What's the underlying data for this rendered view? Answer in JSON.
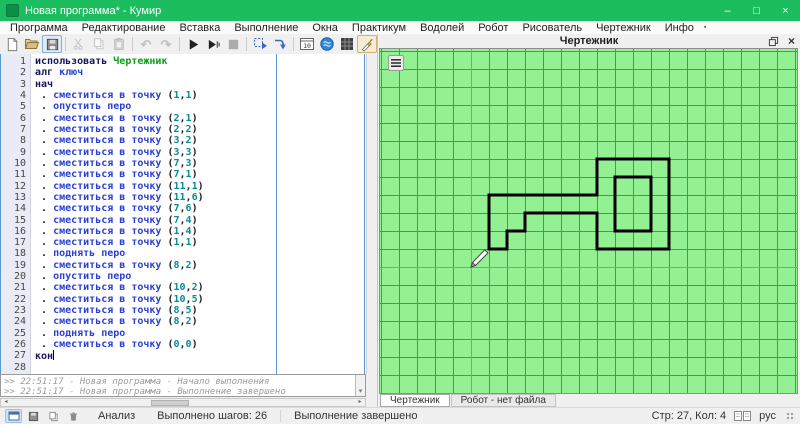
{
  "window": {
    "title": "Новая программа* - Кумир",
    "controls": {
      "minimize": "–",
      "maximize": "□",
      "close": "×"
    }
  },
  "menu": {
    "items": [
      "Программа",
      "Редактирование",
      "Вставка",
      "Выполнение",
      "Окна",
      "Практикум",
      "Водолей",
      "Робот",
      "Рисователь",
      "Чертежник",
      "Инфо"
    ],
    "overflow": "▪"
  },
  "toolbar": {
    "buttons": [
      "new-file",
      "open-file",
      "save-file",
      "cut",
      "copy",
      "paste",
      "undo",
      "redo",
      "run",
      "run-to-end",
      "stop",
      "step-over",
      "step-into",
      "show-variables",
      "vodoley-window",
      "robot-field-window",
      "risovatel-window",
      "robot-window",
      "chertezhnik-window"
    ],
    "vars_label": "10",
    "overflow": "▾"
  },
  "editor": {
    "lines": [
      {
        "n": 1,
        "t": [
          [
            "использовать ",
            "kw"
          ],
          [
            "Чертежник",
            "ac"
          ]
        ]
      },
      {
        "n": 2,
        "t": [
          [
            "алг ",
            "kw"
          ],
          [
            "ключ",
            "cm"
          ]
        ]
      },
      {
        "n": 3,
        "t": [
          [
            "нач",
            "kw"
          ]
        ]
      },
      {
        "n": 4,
        "t": [
          [
            " . ",
            "pl"
          ],
          [
            "сместиться в точку ",
            "cm"
          ],
          [
            "(",
            "pl"
          ],
          [
            "1",
            "nu"
          ],
          [
            ",",
            "pl"
          ],
          [
            "1",
            "nu"
          ],
          [
            ")",
            "pl"
          ]
        ]
      },
      {
        "n": 5,
        "t": [
          [
            " . ",
            "pl"
          ],
          [
            "опустить перо",
            "cm"
          ]
        ]
      },
      {
        "n": 6,
        "t": [
          [
            " . ",
            "pl"
          ],
          [
            "сместиться в точку ",
            "cm"
          ],
          [
            "(",
            "pl"
          ],
          [
            "2",
            "nu"
          ],
          [
            ",",
            "pl"
          ],
          [
            "1",
            "nu"
          ],
          [
            ")",
            "pl"
          ]
        ]
      },
      {
        "n": 7,
        "t": [
          [
            " . ",
            "pl"
          ],
          [
            "сместиться в точку ",
            "cm"
          ],
          [
            "(",
            "pl"
          ],
          [
            "2",
            "nu"
          ],
          [
            ",",
            "pl"
          ],
          [
            "2",
            "nu"
          ],
          [
            ")",
            "pl"
          ]
        ]
      },
      {
        "n": 8,
        "t": [
          [
            " . ",
            "pl"
          ],
          [
            "сместиться в точку ",
            "cm"
          ],
          [
            "(",
            "pl"
          ],
          [
            "3",
            "nu"
          ],
          [
            ",",
            "pl"
          ],
          [
            "2",
            "nu"
          ],
          [
            ")",
            "pl"
          ]
        ]
      },
      {
        "n": 9,
        "t": [
          [
            " . ",
            "pl"
          ],
          [
            "сместиться в точку ",
            "cm"
          ],
          [
            "(",
            "pl"
          ],
          [
            "3",
            "nu"
          ],
          [
            ",",
            "pl"
          ],
          [
            "3",
            "nu"
          ],
          [
            ")",
            "pl"
          ]
        ]
      },
      {
        "n": 10,
        "t": [
          [
            " . ",
            "pl"
          ],
          [
            "сместиться в точку ",
            "cm"
          ],
          [
            "(",
            "pl"
          ],
          [
            "7",
            "nu"
          ],
          [
            ",",
            "pl"
          ],
          [
            "3",
            "nu"
          ],
          [
            ")",
            "pl"
          ]
        ]
      },
      {
        "n": 11,
        "t": [
          [
            " . ",
            "pl"
          ],
          [
            "сместиться в точку ",
            "cm"
          ],
          [
            "(",
            "pl"
          ],
          [
            "7",
            "nu"
          ],
          [
            ",",
            "pl"
          ],
          [
            "1",
            "nu"
          ],
          [
            ")",
            "pl"
          ]
        ]
      },
      {
        "n": 12,
        "t": [
          [
            " . ",
            "pl"
          ],
          [
            "сместиться в точку ",
            "cm"
          ],
          [
            "(",
            "pl"
          ],
          [
            "11",
            "nu"
          ],
          [
            ",",
            "pl"
          ],
          [
            "1",
            "nu"
          ],
          [
            ")",
            "pl"
          ]
        ]
      },
      {
        "n": 13,
        "t": [
          [
            " . ",
            "pl"
          ],
          [
            "сместиться в точку ",
            "cm"
          ],
          [
            "(",
            "pl"
          ],
          [
            "11",
            "nu"
          ],
          [
            ",",
            "pl"
          ],
          [
            "6",
            "nu"
          ],
          [
            ")",
            "pl"
          ]
        ]
      },
      {
        "n": 14,
        "t": [
          [
            " . ",
            "pl"
          ],
          [
            "сместиться в точку ",
            "cm"
          ],
          [
            "(",
            "pl"
          ],
          [
            "7",
            "nu"
          ],
          [
            ",",
            "pl"
          ],
          [
            "6",
            "nu"
          ],
          [
            ")",
            "pl"
          ]
        ]
      },
      {
        "n": 15,
        "t": [
          [
            " . ",
            "pl"
          ],
          [
            "сместиться в точку ",
            "cm"
          ],
          [
            "(",
            "pl"
          ],
          [
            "7",
            "nu"
          ],
          [
            ",",
            "pl"
          ],
          [
            "4",
            "nu"
          ],
          [
            ")",
            "pl"
          ]
        ]
      },
      {
        "n": 16,
        "t": [
          [
            " . ",
            "pl"
          ],
          [
            "сместиться в точку ",
            "cm"
          ],
          [
            "(",
            "pl"
          ],
          [
            "1",
            "nu"
          ],
          [
            ",",
            "pl"
          ],
          [
            "4",
            "nu"
          ],
          [
            ")",
            "pl"
          ]
        ]
      },
      {
        "n": 17,
        "t": [
          [
            " . ",
            "pl"
          ],
          [
            "сместиться в точку ",
            "cm"
          ],
          [
            "(",
            "pl"
          ],
          [
            "1",
            "nu"
          ],
          [
            ",",
            "pl"
          ],
          [
            "1",
            "nu"
          ],
          [
            ")",
            "pl"
          ]
        ]
      },
      {
        "n": 18,
        "t": [
          [
            " . ",
            "pl"
          ],
          [
            "поднять перо",
            "cm"
          ]
        ]
      },
      {
        "n": 19,
        "t": [
          [
            " . ",
            "pl"
          ],
          [
            "сместиться в точку ",
            "cm"
          ],
          [
            "(",
            "pl"
          ],
          [
            "8",
            "nu"
          ],
          [
            ",",
            "pl"
          ],
          [
            "2",
            "nu"
          ],
          [
            ")",
            "pl"
          ]
        ]
      },
      {
        "n": 20,
        "t": [
          [
            " . ",
            "pl"
          ],
          [
            "опустить перо",
            "cm"
          ]
        ]
      },
      {
        "n": 21,
        "t": [
          [
            " . ",
            "pl"
          ],
          [
            "сместиться в точку ",
            "cm"
          ],
          [
            "(",
            "pl"
          ],
          [
            "10",
            "nu"
          ],
          [
            ",",
            "pl"
          ],
          [
            "2",
            "nu"
          ],
          [
            ")",
            "pl"
          ]
        ]
      },
      {
        "n": 22,
        "t": [
          [
            " . ",
            "pl"
          ],
          [
            "сместиться в точку ",
            "cm"
          ],
          [
            "(",
            "pl"
          ],
          [
            "10",
            "nu"
          ],
          [
            ",",
            "pl"
          ],
          [
            "5",
            "nu"
          ],
          [
            ")",
            "pl"
          ]
        ]
      },
      {
        "n": 23,
        "t": [
          [
            " . ",
            "pl"
          ],
          [
            "сместиться в точку ",
            "cm"
          ],
          [
            "(",
            "pl"
          ],
          [
            "8",
            "nu"
          ],
          [
            ",",
            "pl"
          ],
          [
            "5",
            "nu"
          ],
          [
            ")",
            "pl"
          ]
        ]
      },
      {
        "n": 24,
        "t": [
          [
            " . ",
            "pl"
          ],
          [
            "сместиться в точку ",
            "cm"
          ],
          [
            "(",
            "pl"
          ],
          [
            "8",
            "nu"
          ],
          [
            ",",
            "pl"
          ],
          [
            "2",
            "nu"
          ],
          [
            ")",
            "pl"
          ]
        ]
      },
      {
        "n": 25,
        "t": [
          [
            " . ",
            "pl"
          ],
          [
            "поднять перо",
            "cm"
          ]
        ]
      },
      {
        "n": 26,
        "t": [
          [
            " . ",
            "pl"
          ],
          [
            "сместиться в точку ",
            "cm"
          ],
          [
            "(",
            "pl"
          ],
          [
            "0",
            "nu"
          ],
          [
            ",",
            "pl"
          ],
          [
            "0",
            "nu"
          ],
          [
            ")",
            "pl"
          ]
        ]
      },
      {
        "n": 27,
        "t": [
          [
            "кон",
            "kw"
          ]
        ],
        "caret": true
      },
      {
        "n": 28,
        "t": []
      }
    ]
  },
  "console": {
    "lines": [
      ">> 22:51:17 - Новая программа - Начало выполнения",
      ">> 22:51:17 - Новая программа - Выполнение завершено"
    ]
  },
  "statusbar": {
    "analysis": "Анализ",
    "steps": "Выполнено шагов: 26",
    "result": "Выполнение завершено",
    "cursor": "Стр: 27, Кол: 4",
    "lang": "рус"
  },
  "panel": {
    "title": "Чертежник",
    "tabs": [
      {
        "label": "Чертежник",
        "active": true
      },
      {
        "label": "Робот - нет файла",
        "active": false
      }
    ]
  },
  "drawing": {
    "unit": 18,
    "origin": [
      91,
      218
    ],
    "outline": [
      [
        1,
        1
      ],
      [
        2,
        1
      ],
      [
        2,
        2
      ],
      [
        3,
        2
      ],
      [
        3,
        3
      ],
      [
        7,
        3
      ],
      [
        7,
        1
      ],
      [
        11,
        1
      ],
      [
        11,
        6
      ],
      [
        7,
        6
      ],
      [
        7,
        4
      ],
      [
        1,
        4
      ],
      [
        1,
        1
      ]
    ],
    "inner": [
      [
        8,
        2
      ],
      [
        10,
        2
      ],
      [
        10,
        5
      ],
      [
        8,
        5
      ],
      [
        8,
        2
      ]
    ],
    "pen": [
      0,
      0
    ],
    "colors": {
      "bg": "#93f093",
      "grid": "#3fa23f",
      "axis": "#b49a28",
      "line": "#000000"
    }
  }
}
